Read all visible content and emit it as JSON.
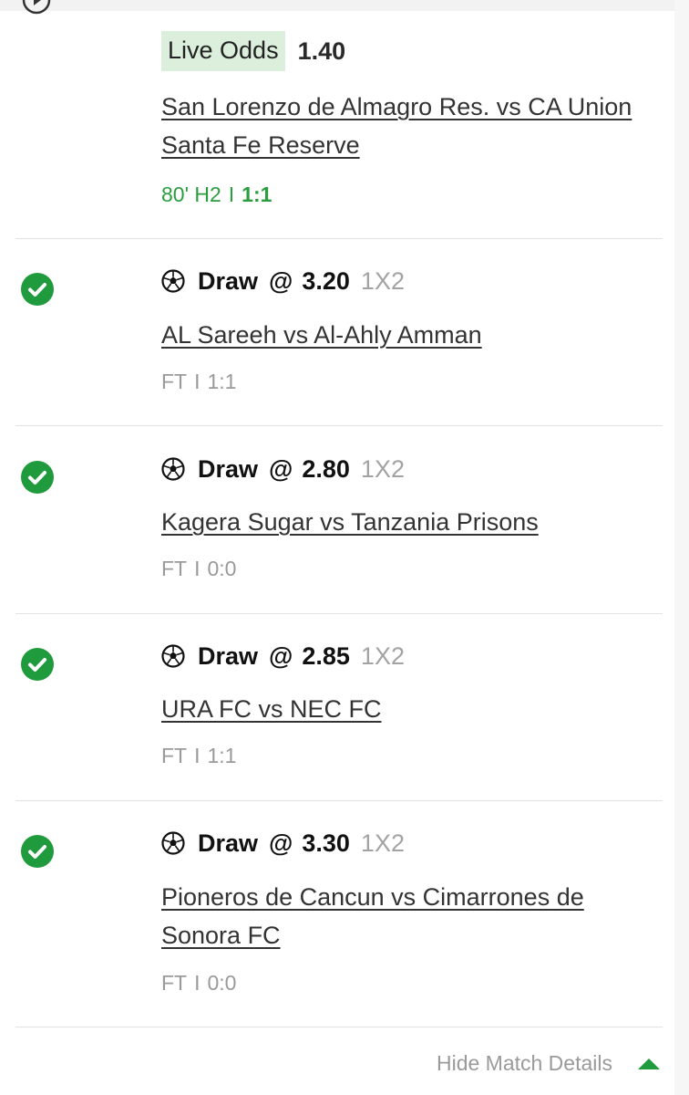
{
  "colors": {
    "accent_green": "#1f9a3c",
    "live_badge_bg": "#dcefdc",
    "muted": "#9a9a9a"
  },
  "live_bet": {
    "badge": "Live Odds",
    "odds": "1.40",
    "match": "San Lorenzo de Almagro Res. vs CA Union Santa Fe Reserve",
    "status_time": "80' H2",
    "separator": "I",
    "score": "1:1",
    "icon": "play-circle-icon"
  },
  "bets": [
    {
      "pick": "Draw",
      "at": "@",
      "odds": "3.20",
      "market": "1X2",
      "match": "AL Sareeh vs Al-Ahly Amman",
      "status": "FT",
      "separator": "I",
      "score": "1:1",
      "result_icon": "check-circle-icon"
    },
    {
      "pick": "Draw",
      "at": "@",
      "odds": "2.80",
      "market": "1X2",
      "match": "Kagera Sugar vs Tanzania Prisons",
      "status": "FT",
      "separator": "I",
      "score": "0:0",
      "result_icon": "check-circle-icon"
    },
    {
      "pick": "Draw",
      "at": "@",
      "odds": "2.85",
      "market": "1X2",
      "match": "URA FC vs NEC FC",
      "status": "FT",
      "separator": "I",
      "score": "1:1",
      "result_icon": "check-circle-icon"
    },
    {
      "pick": "Draw",
      "at": "@",
      "odds": "3.30",
      "market": "1X2",
      "match": "Pioneros de Cancun vs Cimarrones de Sonora FC",
      "status": "FT",
      "separator": "I",
      "score": "0:0",
      "result_icon": "check-circle-icon"
    }
  ],
  "footer": {
    "hide_details_label": "Hide Match Details",
    "icon": "caret-up-icon"
  }
}
